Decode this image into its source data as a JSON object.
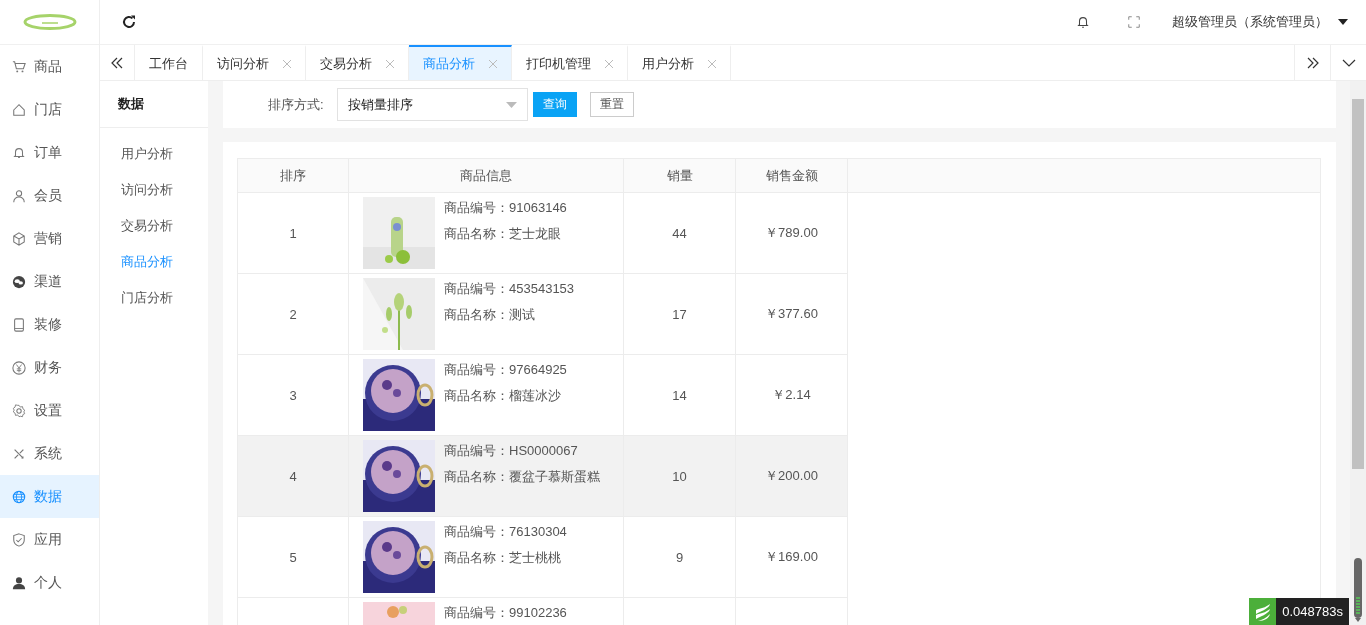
{
  "sidebar": {
    "items": [
      {
        "label": "商品",
        "selected": false
      },
      {
        "label": "门店",
        "selected": false
      },
      {
        "label": "订单",
        "selected": false
      },
      {
        "label": "会员",
        "selected": false
      },
      {
        "label": "营销",
        "selected": false
      },
      {
        "label": "渠道",
        "selected": false
      },
      {
        "label": "装修",
        "selected": false
      },
      {
        "label": "财务",
        "selected": false
      },
      {
        "label": "设置",
        "selected": false
      },
      {
        "label": "系统",
        "selected": false
      },
      {
        "label": "数据",
        "selected": true
      },
      {
        "label": "应用",
        "selected": false
      },
      {
        "label": "个人",
        "selected": false
      }
    ]
  },
  "header": {
    "user": "超级管理员（系统管理员）"
  },
  "tabs": [
    {
      "label": "工作台",
      "selected": false,
      "closable": false
    },
    {
      "label": "访问分析",
      "selected": false,
      "closable": true
    },
    {
      "label": "交易分析",
      "selected": false,
      "closable": true
    },
    {
      "label": "商品分析",
      "selected": true,
      "closable": true
    },
    {
      "label": "打印机管理",
      "selected": false,
      "closable": true
    },
    {
      "label": "用户分析",
      "selected": false,
      "closable": true
    }
  ],
  "submenu": {
    "title": "数据",
    "items": [
      {
        "label": "用户分析",
        "selected": false
      },
      {
        "label": "访问分析",
        "selected": false
      },
      {
        "label": "交易分析",
        "selected": false
      },
      {
        "label": "商品分析",
        "selected": true
      },
      {
        "label": "门店分析",
        "selected": false
      }
    ]
  },
  "filter": {
    "label": "排序方式:",
    "select_value": "按销量排序",
    "buttons": [
      {
        "label": "查询",
        "kind": "primary"
      },
      {
        "label": "重置",
        "kind": "default"
      }
    ]
  },
  "table": {
    "columns": [
      "排序",
      "商品信息",
      "销量",
      "销售金额"
    ],
    "rows": [
      {
        "rank": "1",
        "code_label": "商品编号：",
        "code": "91063146",
        "name_label": "商品名称：",
        "name": "芝士龙眼",
        "sales": "44",
        "amount": "￥789.00",
        "highlighted": false
      },
      {
        "rank": "2",
        "code_label": "商品编号：",
        "code": "453543153",
        "name_label": "商品名称：",
        "name": "测试",
        "sales": "17",
        "amount": "￥377.60",
        "highlighted": false
      },
      {
        "rank": "3",
        "code_label": "商品编号：",
        "code": "97664925",
        "name_label": "商品名称：",
        "name": "榴莲冰沙",
        "sales": "14",
        "amount": "￥2.14",
        "highlighted": false
      },
      {
        "rank": "4",
        "code_label": "商品编号：",
        "code": "HS0000067",
        "name_label": "商品名称：",
        "name": "覆盆子慕斯蛋糕",
        "sales": "10",
        "amount": "￥200.00",
        "highlighted": true
      },
      {
        "rank": "5",
        "code_label": "商品编号：",
        "code": "76130304",
        "name_label": "商品名称：",
        "name": "芝士桃桃",
        "sales": "9",
        "amount": "￥169.00",
        "highlighted": false
      },
      {
        "code_label": "商品编号：",
        "code": "99102236",
        "highlighted": false
      }
    ]
  },
  "debug": {
    "time": "0.048783s"
  }
}
